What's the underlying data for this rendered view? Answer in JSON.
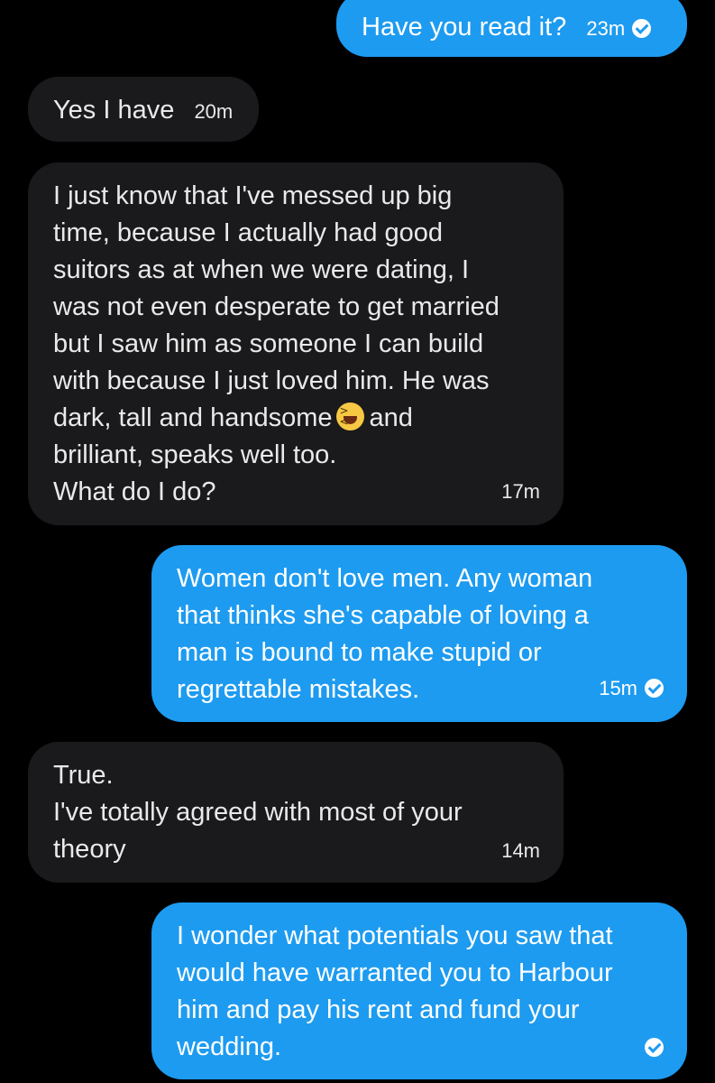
{
  "messages": [
    {
      "id": "m1",
      "side": "sent",
      "text": "Have you read it?",
      "time": "23m",
      "status": "seen"
    },
    {
      "id": "m2",
      "side": "received",
      "text": "Yes I have",
      "time": "20m"
    },
    {
      "id": "m3",
      "side": "received",
      "text_before_emoji": "I just know that I've messed up big\ntime, because I actually had good\nsuitors as at when we were dating, I\nwas not even desperate to get married\nbut I saw him as someone I can build\nwith because I just loved him. He was\ndark, tall and handsome",
      "emoji": "grinning-squinting-face",
      "text_after_emoji": "and\nbrilliant, speaks well too.\nWhat do I do?",
      "time": "17m"
    },
    {
      "id": "m4",
      "side": "sent",
      "text": "Women don't love men. Any woman\nthat thinks she's capable of loving a\nman is bound to make stupid or\nregrettable mistakes.",
      "time": "15m",
      "status": "seen"
    },
    {
      "id": "m5",
      "side": "received",
      "text": "True.\nI've totally agreed with most of your\ntheory",
      "time": "14m"
    },
    {
      "id": "m6",
      "side": "sent",
      "text": "I wonder what potentials you saw that\nwould have warranted you to Harbour\nhim and pay his rent and fund your\nwedding.",
      "time": "",
      "status": "seen"
    }
  ],
  "colors": {
    "background": "#000000",
    "sent_bubble": "#1d9bf0",
    "received_bubble": "#1a1a1c",
    "text": "#ffffff"
  }
}
